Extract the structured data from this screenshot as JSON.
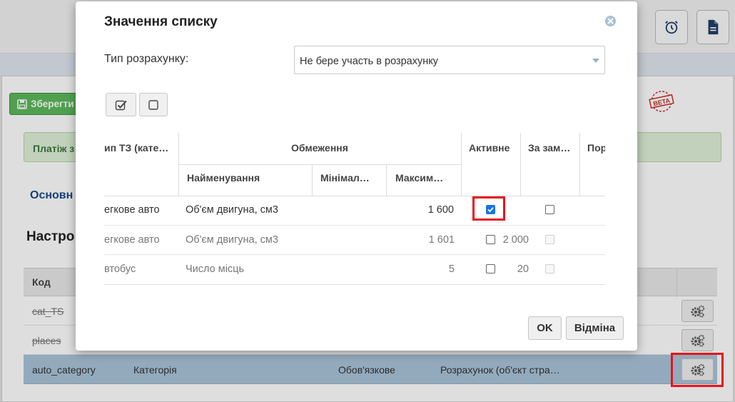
{
  "page": {
    "save_label": "Зберегти",
    "alert_text": "Платіж з",
    "tab_main": "Основн",
    "section_title": "Настро",
    "beta_label": "BETA"
  },
  "bg_table": {
    "header_code": "Код",
    "rows": [
      {
        "code": "cat_TS",
        "struck": true
      },
      {
        "code": "places",
        "struck": true
      },
      {
        "code": "auto_category",
        "name": "Категорія",
        "required": "Обов'язкове",
        "usage": "Розрахунок (об'єкт стра…"
      }
    ]
  },
  "modal": {
    "title": "Значення списку",
    "calc_type_label": "Тип розрахунку:",
    "calc_type_value": "Не бере участь в розрахунку",
    "ok_label": "OK",
    "cancel_label": "Відміна",
    "columns": {
      "vehicle_type": "ип ТЗ (кате…",
      "limits": "Обмеження",
      "limit_name": "Найменування",
      "limit_min": "Мінімал…",
      "limit_max": "Максим…",
      "active": "Активне",
      "default": "За зам…",
      "order": "Пор"
    },
    "rows": [
      {
        "vehicle_type": "егкове авто",
        "limit_name": "Об'єм двигуна, см3",
        "min": "",
        "max": "1 600",
        "active": true,
        "default": false,
        "disabled": false
      },
      {
        "vehicle_type": "егкове авто",
        "limit_name": "Об'єм двигуна, см3",
        "min": "1 601",
        "max": "2 000",
        "active": false,
        "default": false,
        "disabled": true
      },
      {
        "vehicle_type": "втобус",
        "limit_name": "Число місць",
        "min": "5",
        "max": "20",
        "active": false,
        "default": false,
        "disabled": true
      }
    ]
  },
  "colors": {
    "accent_blue": "#1a4b8c",
    "success_green": "#5cb85c",
    "highlight_red": "#e8131b",
    "selected_row": "#a9c4da"
  },
  "icons": [
    "alarm-clock-icon",
    "document-icon",
    "save-icon",
    "close-icon",
    "check-all-icon",
    "uncheck-all-icon",
    "gears-icon",
    "beta-stamp-icon"
  ]
}
